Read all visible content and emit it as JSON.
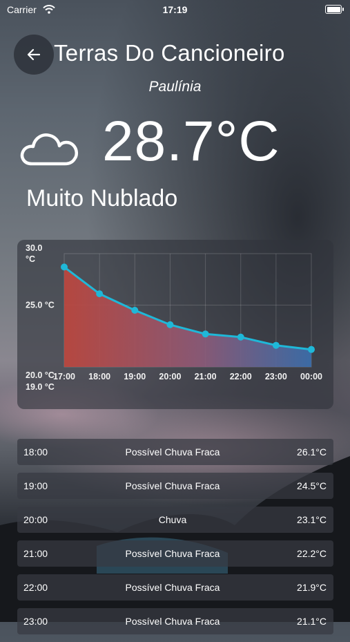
{
  "status_bar": {
    "carrier": "Carrier",
    "time": "17:19"
  },
  "header": {
    "title": "Terras Do Cancioneiro",
    "subtitle": "Paulínia"
  },
  "current": {
    "temperature": "28.7°C",
    "condition": "Muito Nublado",
    "icon": "cloud-icon"
  },
  "chart_data": {
    "type": "area",
    "x": [
      "17:00",
      "18:00",
      "19:00",
      "20:00",
      "21:00",
      "22:00",
      "23:00",
      "00:00"
    ],
    "values": [
      28.7,
      26.1,
      24.5,
      23.1,
      22.2,
      21.9,
      21.1,
      20.7
    ],
    "ylim": [
      19.0,
      30.0
    ],
    "y_tick_labels": [
      "30.0 °C",
      "25.0 °C",
      "20.0 °C",
      "19.0 °C"
    ],
    "y_ticks": [
      30.0,
      25.0,
      20.0,
      19.0
    ],
    "grid": true,
    "colors": {
      "line": "#1fb8d8",
      "fill_start": "#c0463d",
      "fill_end": "#3b6fae"
    }
  },
  "forecast": [
    {
      "time": "18:00",
      "desc": "Possível Chuva Fraca",
      "temp": "26.1°C"
    },
    {
      "time": "19:00",
      "desc": "Possível Chuva Fraca",
      "temp": "24.5°C"
    },
    {
      "time": "20:00",
      "desc": "Chuva",
      "temp": "23.1°C"
    },
    {
      "time": "21:00",
      "desc": "Possível Chuva Fraca",
      "temp": "22.2°C"
    },
    {
      "time": "22:00",
      "desc": "Possível Chuva Fraca",
      "temp": "21.9°C"
    },
    {
      "time": "23:00",
      "desc": "Possível Chuva Fraca",
      "temp": "21.1°C"
    }
  ]
}
